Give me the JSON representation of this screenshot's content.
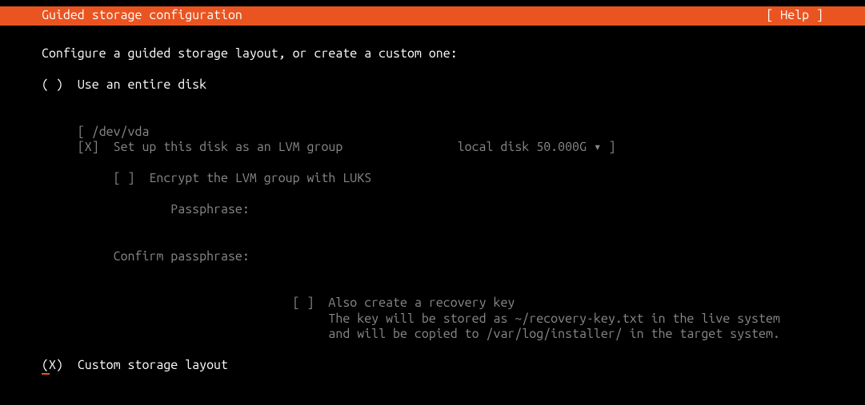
{
  "titlebar": {
    "title": "Guided storage configuration",
    "help": "[ Help ]"
  },
  "intro": "Configure a guided storage layout, or create a custom one:",
  "opt_entire": {
    "radio": "( )",
    "label": "Use an entire disk"
  },
  "disk_select": {
    "open": "[ ",
    "path": "/dev/vda",
    "info": "local disk 50.000G ▾ ",
    "close": "]"
  },
  "lvm": {
    "check": "[X]",
    "label": "Set up this disk as an LVM group"
  },
  "encrypt": {
    "check": "[ ]",
    "label": "Encrypt the LVM group with LUKS"
  },
  "passphrase_label": "Passphrase:",
  "confirm_label": "Confirm passphrase:",
  "recovery": {
    "check": "[ ]",
    "label": "Also create a recovery key",
    "line2": "The key will be stored as ~/recovery-key.txt in the live system",
    "line3": "and will be copied to /var/log/installer/ in the target system."
  },
  "opt_custom": {
    "radio": "(X)",
    "label": "Custom storage layout"
  }
}
